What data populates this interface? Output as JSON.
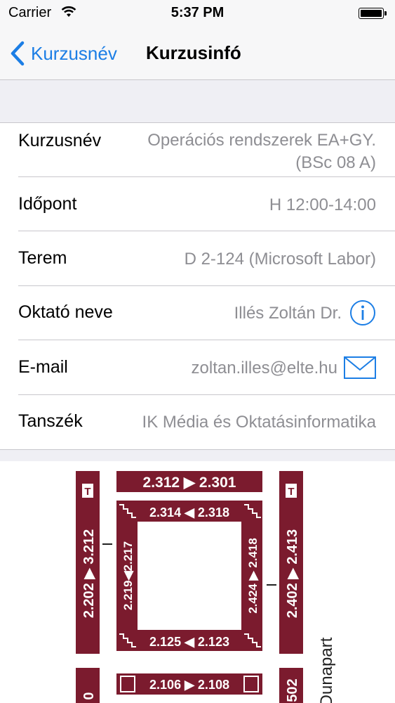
{
  "status_bar": {
    "carrier": "Carrier",
    "time": "5:37 PM"
  },
  "nav": {
    "back_label": "Kurzusnév",
    "title": "Kurzusinfó"
  },
  "rows": [
    {
      "label": "Kurzusnév",
      "value_line1": "Operációs rendszerek EA+GY.",
      "value_line2": "(BSc 08 A)"
    },
    {
      "label": "Időpont",
      "value": "H 12:00-14:00"
    },
    {
      "label": "Terem",
      "value": "D 2-124 (Microsoft Labor)"
    },
    {
      "label": "Oktató neve",
      "value": "Illés Zoltán Dr.",
      "icon": "info-icon"
    },
    {
      "label": "E-mail",
      "value": "zoltan.illes@elte.hu",
      "icon": "mail-icon"
    },
    {
      "label": "Tanszék",
      "value": "IK Média és Oktatásinformatika"
    }
  ],
  "map": {
    "top_corridor": "2.312 ▶ 2.301",
    "inner_top": "2.314 ◀ 2.318",
    "inner_bottom": "2.125 ◀ 2.123",
    "bottom_corridor": "2.106 ▶ 2.108",
    "left_outer": "2.202 ▶ 3.212",
    "left_inner": "2.219◀2.217",
    "right_inner": "2.424 ▶ 2.418",
    "right_outer": "2.402 ▶ 2.413",
    "left_bottom_cut": "0",
    "right_bottom_cut": "502",
    "toilet_left": "T",
    "toilet_right": "T",
    "street": "Dunapart",
    "color": "#7b1b2e"
  },
  "colors": {
    "tint": "#1c7ee5",
    "secondary_text": "#8e8e93",
    "separator": "#c8c7cc"
  }
}
